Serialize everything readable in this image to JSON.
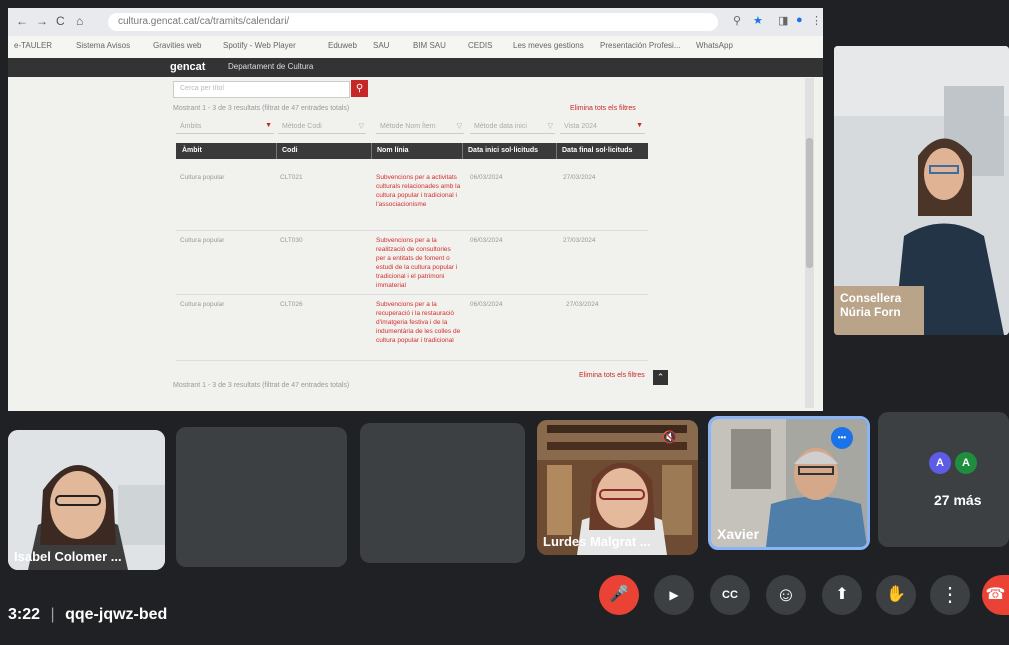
{
  "browser": {
    "url": "cultura.gencat.cat/ca/tramits/calendari/",
    "nav": {
      "back": "←",
      "forward": "→",
      "reload": "C",
      "home": "⌂"
    },
    "bookmarks": [
      "e-TAULER",
      "Sistema Avisos",
      "Gravities web",
      "Spotify - Web Player",
      "Eduweb",
      "SAU",
      "BIM SAU",
      "CEDIS",
      "Les meves gestions",
      "Presentación Profesi...",
      "WhatsApp"
    ]
  },
  "site": {
    "logo": "gencat",
    "department": "Departament de Cultura"
  },
  "search": {
    "placeholder": "Cerca per títol",
    "button": "⚲"
  },
  "results": {
    "count_top": "Mostrant 1 - 3 de 3 resultats (filtrat de 47 entrades totals)",
    "clear_filters": "Elimina tots els filtres",
    "filters": [
      "Àmbits",
      "Mètode Codi",
      "Mètode Nom Ítem",
      "Mètode data inici",
      "Vista 2024"
    ],
    "columns": [
      "Àmbit",
      "Codi",
      "Nom línia",
      "Data inici sol·licituds",
      "Data final sol·licituds"
    ],
    "rows": [
      {
        "ambit": "Cultura popular",
        "codi": "CLT021",
        "nom": "Subvencions per a activitats culturals relacionades amb la cultura popular i tradicional i l'associacionisme",
        "inici": "06/03/2024",
        "final": "27/03/2024"
      },
      {
        "ambit": "Cultura popular",
        "codi": "CLT030",
        "nom": "Subvencions per a la realització de consultories per a entitats de foment o estudi de la cultura popular i tradicional i el patrimoni immaterial",
        "inici": "06/03/2024",
        "final": "27/03/2024"
      },
      {
        "ambit": "Cultura popular",
        "codi": "CLT026",
        "nom": "Subvencions per a la recuperació i la restauració d'imatgeria festiva i de la indumentària de les colles de cultura popular i tradicional",
        "inici": "06/03/2024",
        "final": "27/03/2024"
      }
    ],
    "count_bottom": "Mostrant 1 - 3 de 3 resultats (filtrat de 47 entrades totals)",
    "more_link": "Elimina tots els filtres"
  },
  "participants": {
    "featured": {
      "name_line1": "Consellera",
      "name_line2": "Núria Forn"
    },
    "isabel": "Isabel Colomer ...",
    "lurdes": "Lurdes Malgrat ...",
    "xavier": "Xavier",
    "more_label": "27 más",
    "more_avatars": [
      "A",
      "A"
    ],
    "more_avatar_colors": [
      "#5e5ce6",
      "#1e8e3e"
    ],
    "options_glyph": "•••"
  },
  "meeting": {
    "time": "3:22",
    "separator": "|",
    "code": "qqe-jqwz-bed"
  },
  "controls": {
    "mic": "🎤",
    "camera": "▶",
    "captions": "CC",
    "emoji": "☺",
    "present": "⬆",
    "hand": "✋",
    "more": "⋮",
    "end": "☎"
  },
  "colors": {
    "accent_red": "#ea4335",
    "gencat_red": "#c62828",
    "tile_bg": "#3c4043",
    "blue_highlight": "#8ab4f8"
  }
}
